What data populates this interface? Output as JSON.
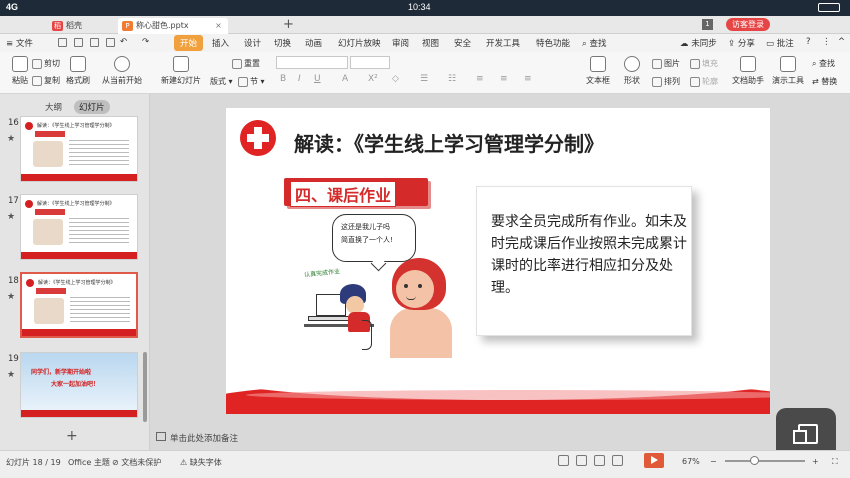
{
  "status_bar": {
    "signal": "4G",
    "time": "10:34"
  },
  "tabs": [
    {
      "label": "稻壳",
      "icon": "稻"
    },
    {
      "label": "称心甜色.pptx",
      "icon": "P"
    }
  ],
  "window": {
    "count": "1",
    "visitor_label": "访客登录"
  },
  "menu": {
    "file": "文件",
    "items": [
      "开始",
      "插入",
      "设计",
      "切换",
      "动画",
      "幻灯片放映",
      "审阅",
      "视图",
      "安全",
      "开发工具",
      "特色功能"
    ],
    "search": "查找",
    "sync": "未同步",
    "share": "分享",
    "comment": "批注"
  },
  "ribbon": {
    "cut": "剪切",
    "copy": "复制",
    "format_painter": "格式刷",
    "paste": "粘贴",
    "from_current": "从当前开始",
    "new_slide": "新建幻灯片",
    "layout": "版式",
    "section": "节",
    "reset": "重置",
    "textbox": "文本框",
    "shape": "形状",
    "arrange": "排列",
    "picture": "图片",
    "fill": "填充",
    "outline": "轮廓",
    "doc_assistant": "文档助手",
    "presentation_tools": "演示工具",
    "find": "查找",
    "replace": "替换"
  },
  "panel": {
    "tab_outline": "大纲",
    "tab_slides": "幻灯片",
    "thumbnails": [
      {
        "number": "16",
        "title": "解读：《学生线上学习管理学分制》"
      },
      {
        "number": "17",
        "title": "解读：《学生线上学习管理学分制》"
      },
      {
        "number": "18",
        "title": "解读：《学生线上学习管理学分制》"
      },
      {
        "number": "19",
        "banner1": "同学们，新学期开始啦",
        "banner2": "大家一起加油吧！"
      }
    ],
    "add_slide": "+"
  },
  "slide": {
    "title": "解读：《学生线上学习管理学分制》",
    "section": "四、课后作业",
    "body": "要求全员完成所有作业。如未及时完成课后作业按照未完成累计课时的比率进行相应扣分及处理。",
    "bubble_line1": "这还是我儿子吗",
    "bubble_line2": "简直换了一个人!",
    "sticker": "认真完成作业"
  },
  "notes": {
    "placeholder": "单击此处添加备注"
  },
  "bottom_status": {
    "slide_counter": "幻灯片 18 / 19",
    "theme": "Office 主题",
    "doc_state": "文档未保护",
    "missing_font": "缺失字体",
    "zoom": "67%"
  },
  "colors": {
    "accent_red": "#d42a2a",
    "active_tab": "#f0a03c"
  }
}
